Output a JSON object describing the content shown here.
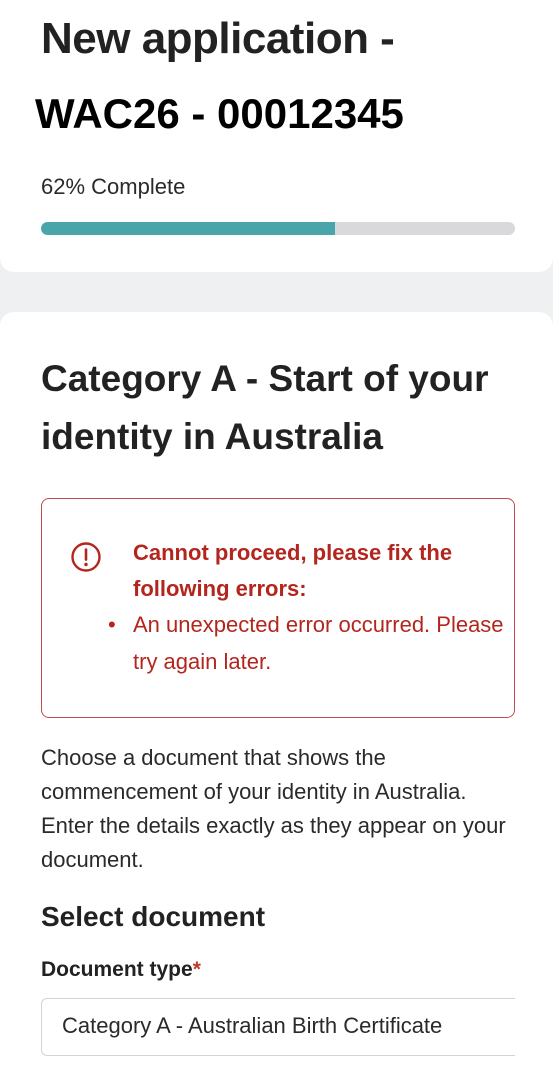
{
  "header": {
    "title": "New application -",
    "reference": "WAC26 - 00012345",
    "progress_label": "62% Complete",
    "progress_percent": 62,
    "progress_color": "#4aa5aa"
  },
  "section": {
    "heading": "Category A - Start of your identity in Australia",
    "error": {
      "title": "Cannot proceed, please fix the following errors:",
      "items": [
        "An unexpected error occurred. Please try again later."
      ],
      "color": "#b3261e"
    },
    "intro": "Choose a document that shows the commencement of your identity in Australia. Enter the details exactly as they appear on your document.",
    "select_heading": "Select document",
    "document_type": {
      "label": "Document type",
      "required_mark": "*",
      "value": "Category A - Australian Birth Certificate"
    }
  }
}
